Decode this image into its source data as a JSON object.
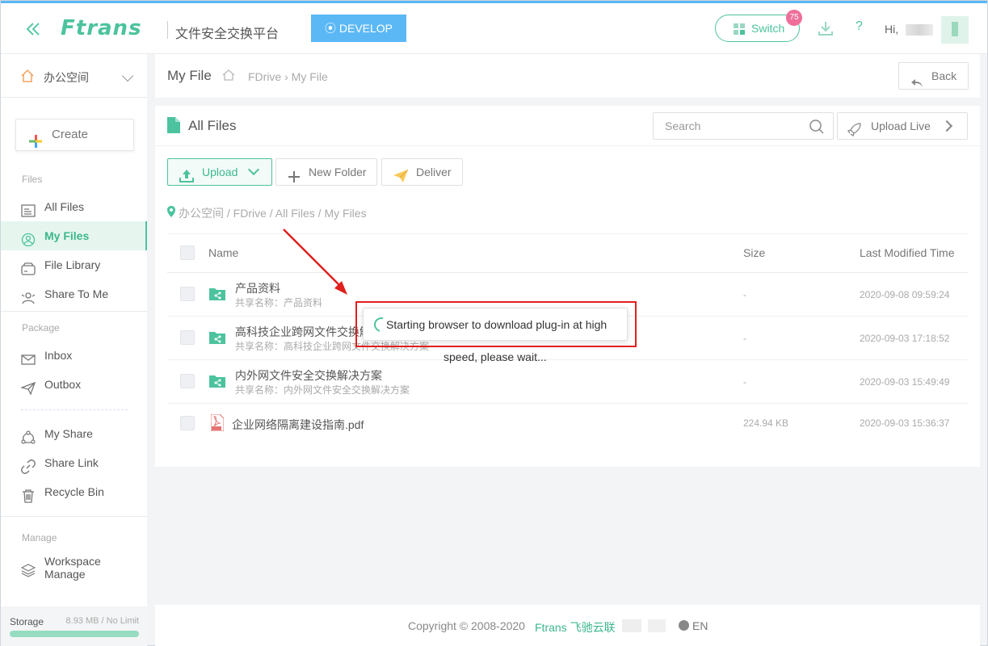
{
  "header": {
    "logo": "Ftrans",
    "platform_name": "文件安全交换平台",
    "env_label": "DEVELOP",
    "switch_label": "Switch",
    "notification_count": "75",
    "help": "?",
    "greeting": "Hi,"
  },
  "sidebar": {
    "workspace": "办公空间",
    "create_label": "Create",
    "sections": {
      "files": "Files",
      "package": "Package",
      "manage": "Manage"
    },
    "items": [
      {
        "label": "All Files",
        "icon": "all-files-icon"
      },
      {
        "label": "My Files",
        "icon": "my-files-icon",
        "active": true
      },
      {
        "label": "File Library",
        "icon": "file-library-icon"
      },
      {
        "label": "Share To Me",
        "icon": "share-to-me-icon"
      },
      {
        "label": "Inbox",
        "icon": "inbox-icon"
      },
      {
        "label": "Outbox",
        "icon": "outbox-icon"
      },
      {
        "label": "My Share",
        "icon": "my-share-icon"
      },
      {
        "label": "Share Link",
        "icon": "share-link-icon"
      },
      {
        "label": "Recycle Bin",
        "icon": "recycle-bin-icon"
      }
    ],
    "workspace_manage": [
      "Workspace",
      "Manage"
    ],
    "storage": {
      "label": "Storage",
      "value": "8.93 MB / No Limit"
    }
  },
  "breadcrumb": {
    "title": "My File",
    "path": "FDrive › My File",
    "back_label": "Back"
  },
  "files": {
    "title": "All Files",
    "search_placeholder": "Search",
    "upload_live_label": "Upload Live",
    "upload_label": "Upload",
    "new_folder_label": "New Folder",
    "deliver_label": "Deliver",
    "location": "办公空间 / FDrive / All Files / My Files",
    "columns": {
      "name": "Name",
      "size": "Size",
      "modified": "Last Modified Time"
    },
    "rows": [
      {
        "name": "产品资料",
        "share": "共享名称：产品资料",
        "size": "-",
        "time": "2020-09-08 09:59:24",
        "type": "shared-folder"
      },
      {
        "name": "高科技企业跨网文件交换解决方案",
        "share": "共享名称：高科技企业跨网文件交换解决方案",
        "size": "-",
        "time": "2020-09-03 17:18:52",
        "type": "shared-folder"
      },
      {
        "name": "内外网文件安全交换解决方案",
        "share": "共享名称：内外网文件安全交换解决方案",
        "size": "-",
        "time": "2020-09-03 15:49:49",
        "type": "shared-folder"
      },
      {
        "name": "企业网络隔离建设指南.pdf",
        "share": "",
        "size": "224.94 KB",
        "time": "2020-09-03 15:36:37",
        "type": "pdf"
      }
    ]
  },
  "loading": {
    "line1": "Starting browser to download plug-in at high",
    "line2": "speed, please wait..."
  },
  "footer": {
    "copyright": "Copyright © 2008-2020",
    "brand": "Ftrans 飞驰云联",
    "lang": "EN"
  },
  "colors": {
    "accent": "#4cc39e",
    "env": "#5bb8f5",
    "badge": "#ef6f9a",
    "annotation": "#e0201e"
  }
}
